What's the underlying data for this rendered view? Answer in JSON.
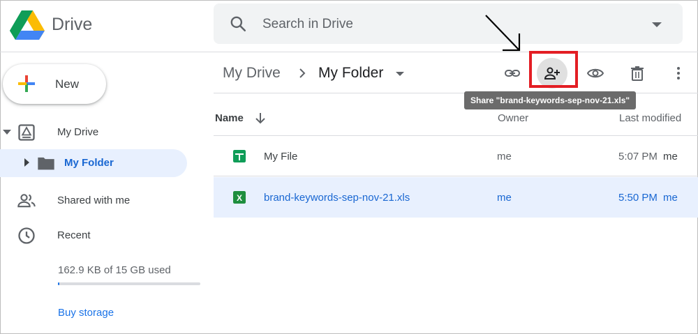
{
  "header": {
    "brand": "Drive",
    "search_placeholder": "Search in Drive"
  },
  "sidebar": {
    "new_label": "New",
    "items": [
      {
        "label": "My Drive",
        "icon": "my-drive-icon"
      },
      {
        "label": "My Folder",
        "icon": "folder-icon",
        "selected": true
      },
      {
        "label": "Shared with me",
        "icon": "people-icon"
      },
      {
        "label": "Recent",
        "icon": "clock-icon"
      }
    ],
    "storage": {
      "text": "162.9 KB of 15 GB used",
      "used_fraction": 0.01
    },
    "buy_storage": "Buy storage"
  },
  "toolbar": {
    "breadcrumb": [
      "My Drive",
      "My Folder"
    ],
    "actions": [
      "link-icon",
      "share-person-add-icon",
      "eye-icon",
      "trash-icon",
      "more-vert-icon"
    ],
    "tooltip": "Share \"brand-keywords-sep-nov-21.xls\""
  },
  "table": {
    "headers": {
      "name": "Name",
      "owner": "Owner",
      "modified": "Last modified"
    },
    "rows": [
      {
        "name": "My File",
        "owner": "me",
        "modified": "5:07 PM",
        "modified_by": "me",
        "icon": "google-sheets-icon",
        "selected": false
      },
      {
        "name": "brand-keywords-sep-nov-21.xls",
        "owner": "me",
        "modified": "5:50 PM",
        "modified_by": "me",
        "icon": "excel-icon",
        "selected": true
      }
    ]
  },
  "colors": {
    "accent": "#1a73e8",
    "selected_bg": "#e8f0fe",
    "highlight_box": "#e31e24",
    "sheets_green": "#0f9d58",
    "excel_green": "#1e8e3e"
  }
}
